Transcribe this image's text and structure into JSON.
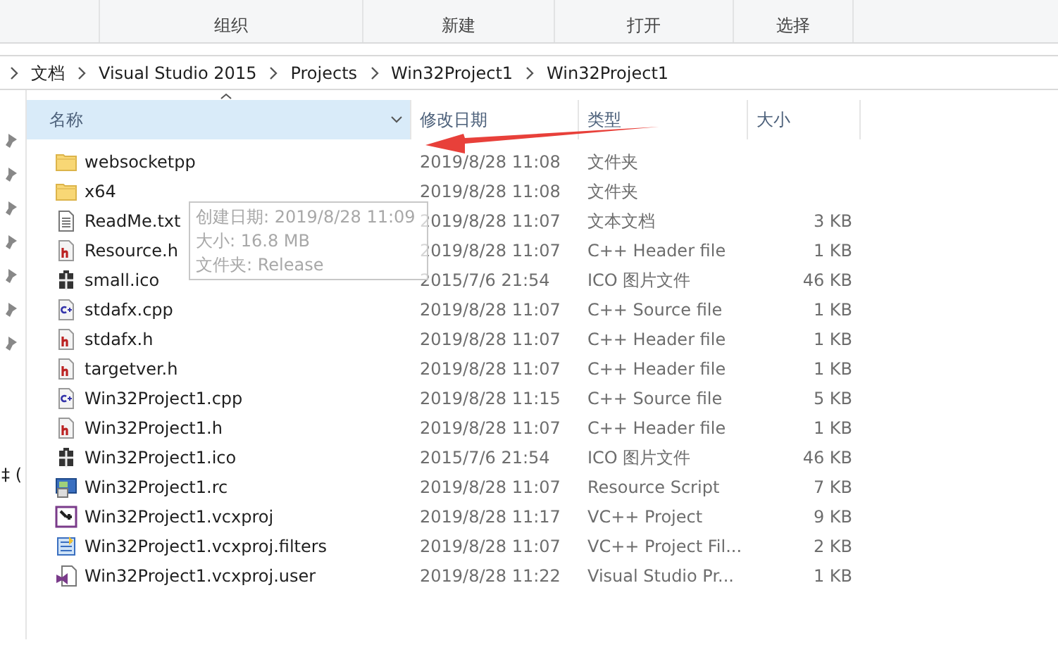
{
  "ribbon": {
    "groups": [
      "组织",
      "新建",
      "打开",
      "选择"
    ]
  },
  "breadcrumbs": [
    "文档",
    "Visual Studio 2015",
    "Projects",
    "Win32Project1",
    "Win32Project1"
  ],
  "nav_pane": {
    "cut_text": "‡ ("
  },
  "columns": [
    {
      "label": "名称",
      "sorted": true
    },
    {
      "label": "修改日期",
      "sorted": false
    },
    {
      "label": "类型",
      "sorted": false
    },
    {
      "label": "大小",
      "sorted": false
    }
  ],
  "files": [
    {
      "kind": "folder",
      "name": "websocketpp",
      "modified": "2019/8/28 11:08",
      "type": "文件夹"
    },
    {
      "kind": "folder",
      "name": "x64",
      "modified": "2019/8/28 11:08",
      "type": "文件夹"
    },
    {
      "kind": "text",
      "name": "ReadMe.txt",
      "modified": "2019/8/28 11:07",
      "type": "文本文档",
      "size": "3 KB"
    },
    {
      "kind": "header",
      "name": "Resource.h",
      "modified": "2019/8/28 11:07",
      "type": "C++ Header file",
      "size": "1 KB"
    },
    {
      "kind": "ico",
      "name": "small.ico",
      "modified": "2015/7/6 21:54",
      "type": "ICO 图片文件",
      "size": "46 KB"
    },
    {
      "kind": "source",
      "name": "stdafx.cpp",
      "modified": "2019/8/28 11:07",
      "type": "C++ Source file",
      "size": "1 KB"
    },
    {
      "kind": "header",
      "name": "stdafx.h",
      "modified": "2019/8/28 11:07",
      "type": "C++ Header file",
      "size": "1 KB"
    },
    {
      "kind": "header",
      "name": "targetver.h",
      "modified": "2019/8/28 11:07",
      "type": "C++ Header file",
      "size": "1 KB"
    },
    {
      "kind": "source",
      "name": "Win32Project1.cpp",
      "modified": "2019/8/28 11:15",
      "type": "C++ Source file",
      "size": "5 KB"
    },
    {
      "kind": "header",
      "name": "Win32Project1.h",
      "modified": "2019/8/28 11:07",
      "type": "C++ Header file",
      "size": "1 KB"
    },
    {
      "kind": "ico",
      "name": "Win32Project1.ico",
      "modified": "2015/7/6 21:54",
      "type": "ICO 图片文件",
      "size": "46 KB"
    },
    {
      "kind": "resource",
      "name": "Win32Project1.rc",
      "modified": "2019/8/28 11:07",
      "type": "Resource Script",
      "size": "7 KB"
    },
    {
      "kind": "project",
      "name": "Win32Project1.vcxproj",
      "modified": "2019/8/28 11:17",
      "type": "VC++ Project",
      "size": "9 KB"
    },
    {
      "kind": "filters",
      "name": "Win32Project1.vcxproj.filters",
      "modified": "2019/8/28 11:07",
      "type": "VC++ Project Fil...",
      "size": "2 KB"
    },
    {
      "kind": "user",
      "name": "Win32Project1.vcxproj.user",
      "modified": "2019/8/28 11:22",
      "type": "Visual Studio Pr...",
      "size": "1 KB"
    }
  ],
  "tooltip": {
    "lines": [
      "创建日期: 2019/8/28 11:09",
      "大小: 16.8 MB",
      "文件夹: Release"
    ]
  },
  "annotations": [
    {
      "kind": "arrow"
    }
  ]
}
